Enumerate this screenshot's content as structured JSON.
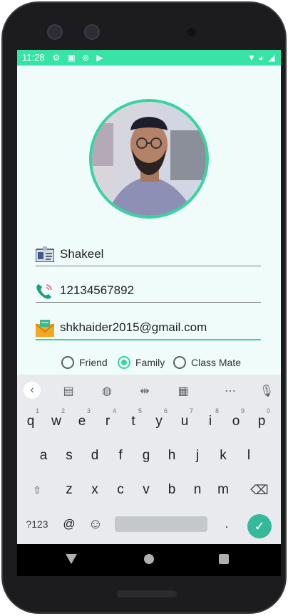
{
  "status": {
    "time": "11:28"
  },
  "profile": {
    "name": "Shakeel",
    "phone": "12134567892",
    "email": "shkhaider2015@gmail.com"
  },
  "relation": {
    "options": [
      "Friend",
      "Family",
      "Class Mate"
    ],
    "selected": "Family"
  },
  "keyboard": {
    "row1": [
      "q",
      "w",
      "e",
      "r",
      "t",
      "y",
      "u",
      "i",
      "o",
      "p"
    ],
    "row1_hints": [
      "1",
      "2",
      "3",
      "4",
      "5",
      "6",
      "7",
      "8",
      "9",
      "0"
    ],
    "row2": [
      "a",
      "s",
      "d",
      "f",
      "g",
      "h",
      "j",
      "k",
      "l"
    ],
    "row3": [
      "z",
      "x",
      "c",
      "v",
      "b",
      "n",
      "m"
    ],
    "symbols_label": "?123",
    "at": "@",
    "period": "."
  },
  "colors": {
    "accent": "#35d4a0",
    "status_bar": "#38e3a7",
    "background": "#effcfa"
  }
}
